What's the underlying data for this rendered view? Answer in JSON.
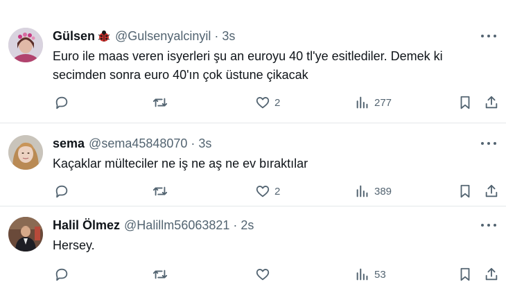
{
  "tweets": [
    {
      "name": "Gülsen",
      "handle": "@Gulsenyalcinyil",
      "dot": "·",
      "time": "3s",
      "text_lines": [
        "Euro ile maas veren isyerleri şu an euroyu 40 tl'ye esitlediler. Demek ki",
        "secimden sonra euro 40'ın çok üstune çikacak"
      ],
      "replies": "",
      "retweets": "",
      "likes": "2",
      "views": "277"
    },
    {
      "name": "sema",
      "handle": "@sema45848070",
      "dot": "·",
      "time": "3s",
      "text_lines": [
        "Kaçaklar mülteciler ne iş ne aş ne ev bıraktılar"
      ],
      "replies": "",
      "retweets": "",
      "likes": "2",
      "views": "389"
    },
    {
      "name": "Halil Ölmez",
      "handle": "@Halillm56063821",
      "dot": "·",
      "time": "2s",
      "text_lines": [
        "Hersey."
      ],
      "replies": "",
      "retweets": "",
      "likes": "",
      "views": "53"
    }
  ],
  "icons": {
    "reply": "reply-icon",
    "retweet": "retweet-icon",
    "like": "like-icon",
    "views": "views-icon",
    "bookmark": "bookmark-icon",
    "share": "share-icon",
    "more": "more-icon",
    "badge": "ladybug-emoji-icon"
  },
  "colors": {
    "text": "#0f1419",
    "secondary": "#536471",
    "divider": "#e3e7ea",
    "ladybug": "#d0312d"
  }
}
